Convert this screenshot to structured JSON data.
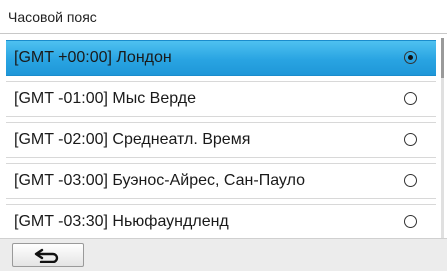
{
  "header": {
    "title": "Часовой пояс"
  },
  "timezones": [
    {
      "label": "[GMT +00:00] Лондон",
      "selected": true
    },
    {
      "label": "[GMT -01:00] Мыс Верде",
      "selected": false
    },
    {
      "label": "[GMT -02:00] Среднеатл. Время",
      "selected": false
    },
    {
      "label": "[GMT -03:00] Буэнос-Айрес, Сан-Пауло",
      "selected": false
    },
    {
      "label": "[GMT -03:30] Ньюфаундленд",
      "selected": false
    }
  ],
  "footer": {
    "back_icon": "back-arrow-icon"
  },
  "colors": {
    "selected_row": "#29a4e2",
    "header_border": "#c8c8c8"
  }
}
